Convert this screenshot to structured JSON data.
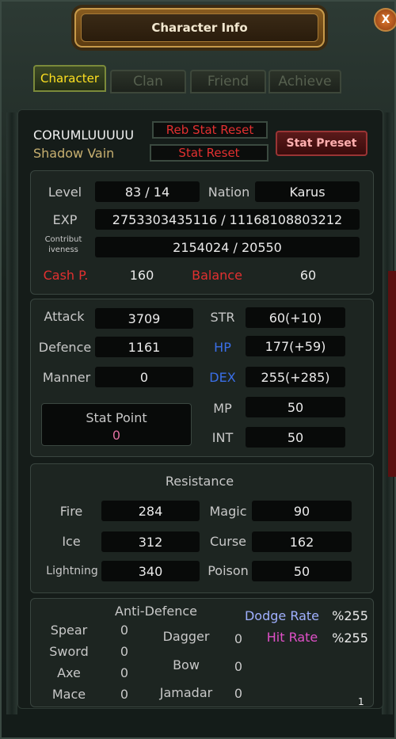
{
  "window": {
    "title": "Character Info",
    "close_label": "X",
    "page_number": "1"
  },
  "tabs": [
    {
      "label": "Character",
      "active": true
    },
    {
      "label": "Clan",
      "active": false
    },
    {
      "label": "Friend",
      "active": false
    },
    {
      "label": "Achieve",
      "active": false
    }
  ],
  "header": {
    "name": "CORUMLUUUUU",
    "class": "Shadow Vain",
    "reb_stat_reset": "Reb Stat Reset",
    "stat_reset": "Stat Reset",
    "stat_preset": "Stat Preset"
  },
  "info": {
    "level_label": "Level",
    "level": "83 / 14",
    "nation_label": "Nation",
    "nation": "Karus",
    "exp_label": "EXP",
    "exp": "2753303435116 / 11168108803212",
    "contrib_label_1": "Contribut",
    "contrib_label_2": "iveness",
    "contrib": "2154024 / 20550",
    "cash_label": "Cash P.",
    "cash": "160",
    "balance_label": "Balance",
    "balance": "60"
  },
  "stats": {
    "attack_label": "Attack",
    "attack": "3709",
    "defence_label": "Defence",
    "defence": "1161",
    "manner_label": "Manner",
    "manner": "0",
    "str_label": "STR",
    "str": "60(+10)",
    "hp_label": "HP",
    "hp": "177(+59)",
    "dex_label": "DEX",
    "dex": "255(+285)",
    "mp_label": "MP",
    "mp": "50",
    "int_label": "INT",
    "int": "50",
    "stat_point_label": "Stat Point",
    "stat_point": "0"
  },
  "resistance": {
    "title": "Resistance",
    "fire_label": "Fire",
    "fire": "284",
    "ice_label": "Ice",
    "ice": "312",
    "lightning_label": "Lightning",
    "lightning": "340",
    "magic_label": "Magic",
    "magic": "90",
    "curse_label": "Curse",
    "curse": "162",
    "poison_label": "Poison",
    "poison": "50"
  },
  "anti_defence": {
    "title": "Anti-Defence",
    "spear_label": "Spear",
    "spear": "0",
    "sword_label": "Sword",
    "sword": "0",
    "axe_label": "Axe",
    "axe": "0",
    "mace_label": "Mace",
    "mace": "0",
    "dagger_label": "Dagger",
    "dagger": "0",
    "bow_label": "Bow",
    "bow": "0",
    "jamadar_label": "Jamadar",
    "jamadar": "0",
    "dodge_label": "Dodge Rate",
    "dodge": "%255",
    "hit_label": "Hit Rate",
    "hit": "%255"
  },
  "colors": {
    "cash_red": "#e23030",
    "hp_blue": "#3a6fe8",
    "dodge_blue": "#a0b0ff",
    "hit_pink": "#e050c8",
    "tab_active": "#ffe020"
  }
}
